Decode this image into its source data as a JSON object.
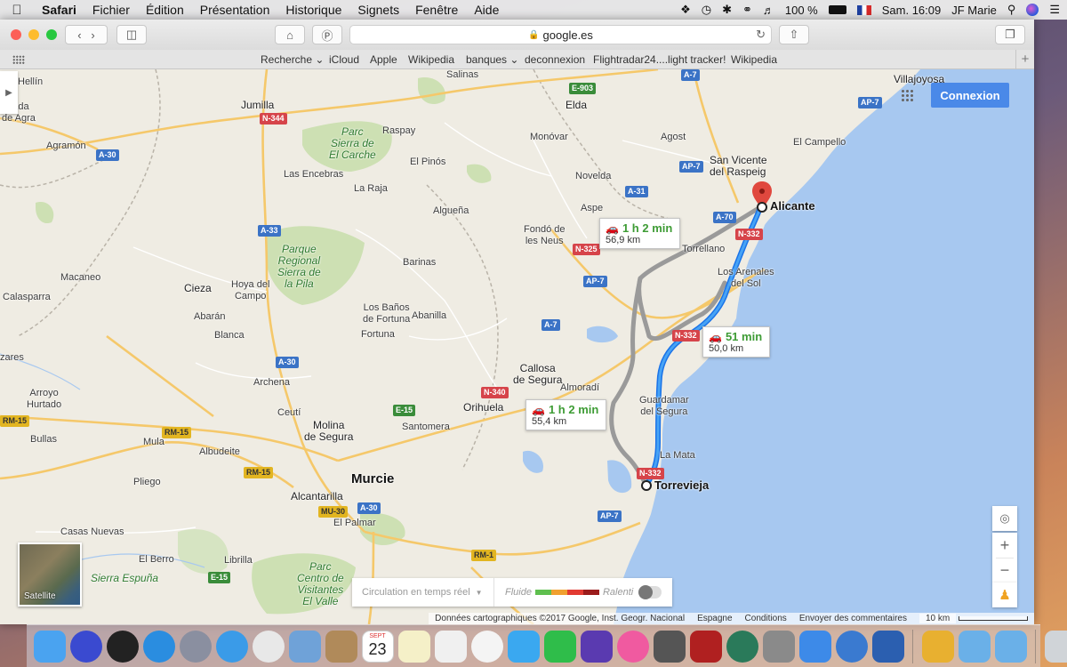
{
  "menubar": {
    "apple_icon": "apple-logo",
    "app_name": "Safari",
    "menus": [
      "Fichier",
      "Édition",
      "Présentation",
      "Historique",
      "Signets",
      "Fenêtre",
      "Aide"
    ],
    "battery": "100 %",
    "clock": "Sam. 16:09",
    "user": "JF Marie",
    "status_icons": [
      "dropbox-icon",
      "time-machine-icon",
      "bluetooth-icon",
      "wifi-icon",
      "volume-icon",
      "battery-icon",
      "flag-fr-icon",
      "search-icon",
      "siri-icon",
      "notification-icon"
    ]
  },
  "safari": {
    "url": "google.es",
    "favorites": [
      {
        "label": "Recherche ⌄"
      },
      {
        "label": "iCloud"
      },
      {
        "label": "Apple"
      },
      {
        "label": "Wikipedia"
      },
      {
        "label": "banques ⌄"
      },
      {
        "label": "deconnexion"
      },
      {
        "label": "Flightradar24....light tracker!"
      },
      {
        "label": "Wikipedia"
      }
    ]
  },
  "map": {
    "connexion_label": "Connexion",
    "satellite_label": "Satellite",
    "traffic": {
      "select_label": "Circulation en temps réel",
      "fluide": "Fluide",
      "ralenti": "Ralenti",
      "colors": [
        "#5fbf4f",
        "#f0a030",
        "#e23a32",
        "#9b1c1c"
      ]
    },
    "routes": [
      {
        "time": "1 h 2 min",
        "distance": "56,9 km"
      },
      {
        "time": "51 min",
        "distance": "50,0 km"
      },
      {
        "time": "1 h 2 min",
        "distance": "55,4 km"
      }
    ],
    "origin": "Torrevieja",
    "destination": "Alicante",
    "places": {
      "hellin": "Hellín",
      "canada": "añada\nde Agra",
      "agramon": "Agramón",
      "jumilla": "Jumilla",
      "parc_carche": "Parc\nSierra de\nEl Carche",
      "raspay": "Raspay",
      "elda": "Elda",
      "salinas": "Salinas",
      "monovar": "Monóvar",
      "agost": "Agost",
      "villajoyosa": "Villajoyosa",
      "el_campello": "El Campello",
      "san_vicente": "San Vicente\ndel Raspeig",
      "las_encebras": "Las Encebras",
      "el_pinos": "El Pinós",
      "la_raja": "La Raja",
      "novelda": "Novelda",
      "aspe": "Aspe",
      "alguena": "Algueña",
      "fondo": "Fondó de\nles Neus",
      "torrellano": "Torrellano",
      "parque_pila": "Parque\nRegional\nSierra de\nla Pila",
      "barinas": "Barinas",
      "arenales": "Los Arenales\ndel Sol",
      "macaneo": "Macaneo",
      "calasparra": "Calasparra",
      "cieza": "Cieza",
      "hoya": "Hoya del\nCampo",
      "abaran": "Abarán",
      "banos": "Los Baños\nde Fortuna",
      "abanilla": "Abanilla",
      "fortuna": "Fortuna",
      "blanca": "Blanca",
      "zarés": "zares",
      "callosa": "Callosa\nde Segura",
      "almoradi": "Almoradí",
      "arroyo": "Arroyo\nHurtado",
      "archena": "Archena",
      "orihuela": "Orihuela",
      "guardamar": "Guardamar\ndel Segura",
      "bullas": "Bullas",
      "ceuti": "Ceutí",
      "mula": "Mula",
      "molina": "Molina\nde Segura",
      "santomera": "Santomera",
      "albudeite": "Albudeite",
      "la_mata": "La Mata",
      "pliego": "Pliego",
      "murcie": "Murcie",
      "alcantarilla": "Alcantarilla",
      "casas_nuevas": "Casas Nuevas",
      "el_palmar": "El Palmar",
      "el_berro": "El Berro",
      "librilla": "Librilla",
      "sierra_espuna": "Sierra Espuña",
      "parc_valle": "Parc\nCentro de\nVisitantes\nEl Valle"
    },
    "shields": {
      "a7_top": "A-7",
      "e903": "E-903",
      "n344": "N-344",
      "a30_a": "A-30",
      "ap7_a": "AP-7",
      "a31": "A-31",
      "a70": "A-70",
      "n332_a": "N-332",
      "a33": "A-33",
      "n325": "N-325",
      "ap7_b": "AP-7",
      "a7_b": "A-7",
      "n332_b": "N-332",
      "a30_b": "A-30",
      "n340": "N-340",
      "e15_a": "E-15",
      "rm15_a": "RM-15",
      "rm15_b": "RM-15",
      "rm15_c": "RM-15",
      "n332_c": "N-332",
      "mu30": "MU-30",
      "a30_c": "A-30",
      "ap7_c": "AP-7",
      "rm1": "RM-1",
      "e15_b": "E-15"
    },
    "footer": {
      "data": "Données cartographiques ©2017 Google, Inst. Geogr. Nacional",
      "country": "Espagne",
      "conditions": "Conditions",
      "feedback": "Envoyer des commentaires",
      "scale": "10 km"
    }
  },
  "dock": {
    "apps": [
      {
        "name": "finder-icon",
        "color": "#4aa3f0"
      },
      {
        "name": "siri-icon",
        "color": "#3a4ad0"
      },
      {
        "name": "dashboard-icon",
        "color": "#222222"
      },
      {
        "name": "app-store-icon",
        "color": "#2a8de0"
      },
      {
        "name": "launchpad-icon",
        "color": "#8a8fa0"
      },
      {
        "name": "safari-icon",
        "color": "#3a9be8"
      },
      {
        "name": "chrome-icon",
        "color": "#e8e8e8"
      },
      {
        "name": "preview-icon",
        "color": "#6fa2d8"
      },
      {
        "name": "contacts-icon",
        "color": "#b08a5a"
      },
      {
        "name": "calendar-icon",
        "color": "#ffffff"
      },
      {
        "name": "notes-icon",
        "color": "#f5f0c8"
      },
      {
        "name": "reminders-icon",
        "color": "#f0f0f0"
      },
      {
        "name": "photos-icon",
        "color": "#f4f4f4"
      },
      {
        "name": "messages-icon",
        "color": "#3aa8f0"
      },
      {
        "name": "facetime-icon",
        "color": "#2fbd4a"
      },
      {
        "name": "imovie-icon",
        "color": "#5a3ab0"
      },
      {
        "name": "itunes-icon",
        "color": "#f05aa0"
      },
      {
        "name": "screenshot-icon",
        "color": "#555555"
      },
      {
        "name": "photo-booth-icon",
        "color": "#b02020"
      },
      {
        "name": "time-machine-icon",
        "color": "#2a7a5a"
      },
      {
        "name": "system-preferences-icon",
        "color": "#8a8a8a"
      },
      {
        "name": "dropbox-icon",
        "color": "#3d8ae8"
      },
      {
        "name": "google-earth-icon",
        "color": "#3a7ad0"
      },
      {
        "name": "word-icon",
        "color": "#2b5fb0"
      },
      {
        "name": "sketchbook-icon",
        "color": "#e8b030"
      },
      {
        "name": "applications-folder-icon",
        "color": "#6ab0e8"
      },
      {
        "name": "downloads-folder-icon",
        "color": "#6ab0e8"
      },
      {
        "name": "trash-icon",
        "color": "#d0d4d8"
      }
    ],
    "calendar_day": "23",
    "calendar_month": "SEPT"
  }
}
